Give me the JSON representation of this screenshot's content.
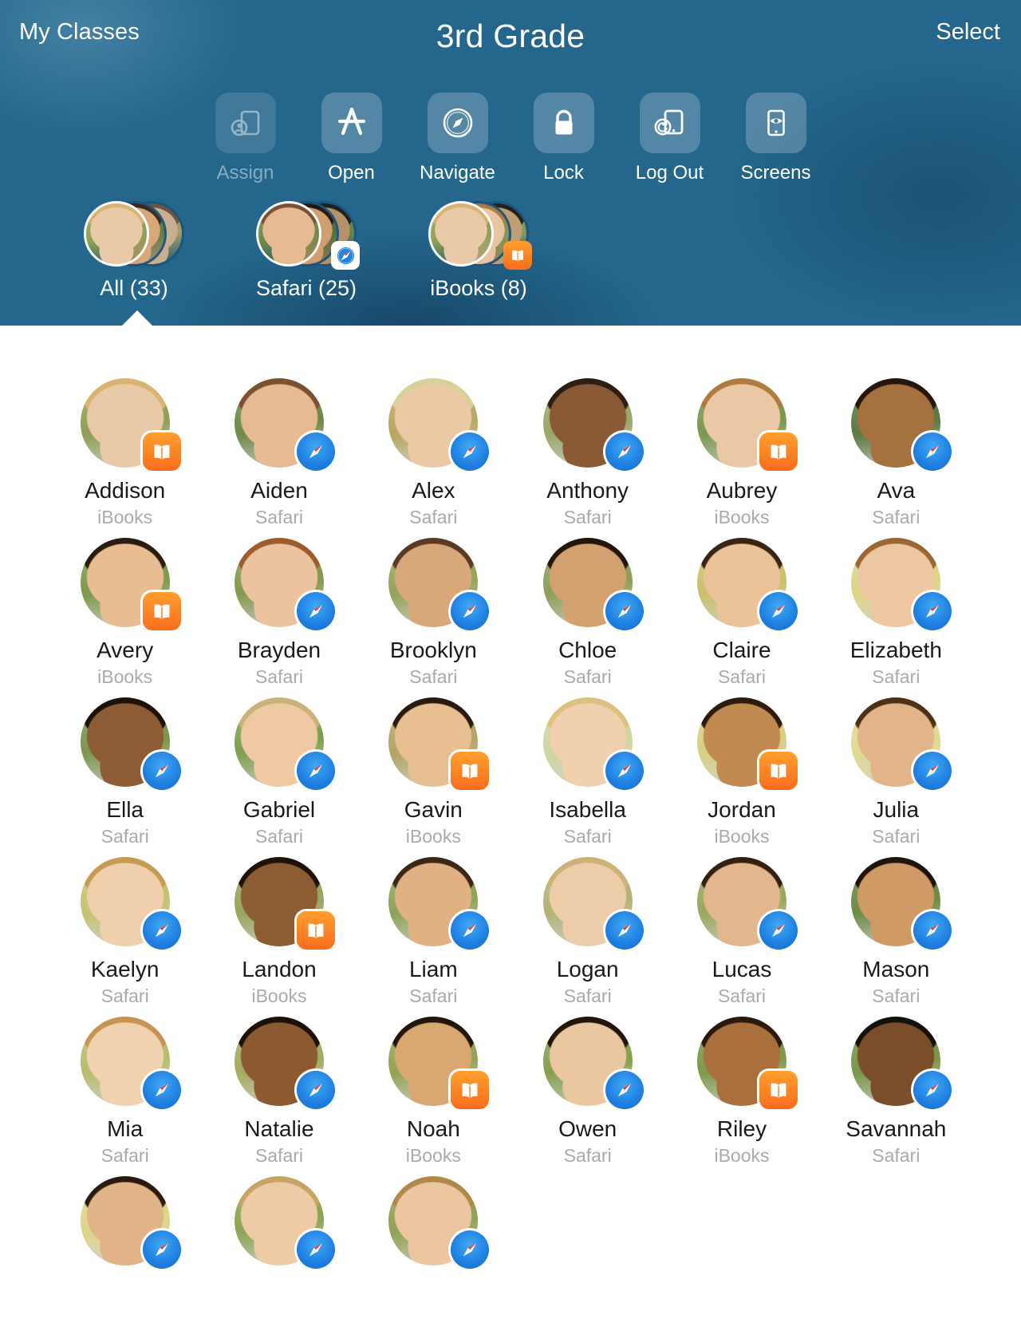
{
  "nav": {
    "back_label": "My Classes",
    "title": "3rd Grade",
    "select_label": "Select"
  },
  "toolbar": {
    "items": [
      {
        "label": "Assign",
        "icon": "assign-device-icon",
        "enabled": false
      },
      {
        "label": "Open",
        "icon": "app-store-icon",
        "enabled": true
      },
      {
        "label": "Navigate",
        "icon": "safari-compass-icon",
        "enabled": true
      },
      {
        "label": "Lock",
        "icon": "lock-icon",
        "enabled": true
      },
      {
        "label": "Log Out",
        "icon": "logout-device-icon",
        "enabled": true
      },
      {
        "label": "Screens",
        "icon": "screen-view-icon",
        "enabled": true
      }
    ]
  },
  "filters": {
    "items": [
      {
        "label": "All (33)",
        "key": "all",
        "badge": "none",
        "active": true
      },
      {
        "label": "Safari (25)",
        "key": "safari",
        "badge": "safari",
        "active": false
      },
      {
        "label": "iBooks (8)",
        "key": "ibooks",
        "badge": "ibooks",
        "active": false
      }
    ]
  },
  "colors": {
    "header_blue": "#24668c",
    "ibooks_orange": "#f87c20",
    "safari_blue": "#1f86e0",
    "name_text": "#1a1a1a",
    "app_text": "#a9a9ae"
  },
  "students": [
    {
      "name": "Addison",
      "app": "iBooks",
      "badge": "ibooks",
      "skin": "#e8c9a8",
      "hair": "#d9b471",
      "bg": "#8fa055"
    },
    {
      "name": "Aiden",
      "app": "Safari",
      "badge": "safari",
      "skin": "#e6bb93",
      "hair": "#7a5231",
      "bg": "#6f8a4a"
    },
    {
      "name": "Alex",
      "app": "Safari",
      "badge": "safari",
      "skin": "#ecc9a5",
      "hair": "#d8cf9a",
      "bg": "#b9a766"
    },
    {
      "name": "Anthony",
      "app": "Safari",
      "badge": "safari",
      "skin": "#8a5a36",
      "hair": "#2d1d12",
      "bg": "#9aa86a"
    },
    {
      "name": "Aubrey",
      "app": "iBooks",
      "badge": "ibooks",
      "skin": "#eac8a6",
      "hair": "#b07b3e",
      "bg": "#7e9750"
    },
    {
      "name": "Ava",
      "app": "Safari",
      "badge": "safari",
      "skin": "#a5713f",
      "hair": "#24160d",
      "bg": "#5d7a42"
    },
    {
      "name": "Avery",
      "app": "iBooks",
      "badge": "ibooks",
      "skin": "#e7bd91",
      "hair": "#2b1c10",
      "bg": "#7e9a4e"
    },
    {
      "name": "Brayden",
      "app": "Safari",
      "badge": "safari",
      "skin": "#ecc3a0",
      "hair": "#9e5c2c",
      "bg": "#87994f"
    },
    {
      "name": "Brooklyn",
      "app": "Safari",
      "badge": "safari",
      "skin": "#d8a87b",
      "hair": "#5a3a22",
      "bg": "#94a45c"
    },
    {
      "name": "Chloe",
      "app": "Safari",
      "badge": "safari",
      "skin": "#d3a070",
      "hair": "#241509",
      "bg": "#8d9f59"
    },
    {
      "name": "Claire",
      "app": "Safari",
      "badge": "safari",
      "skin": "#eac398",
      "hair": "#3a2415",
      "bg": "#cbbf6e"
    },
    {
      "name": "Elizabeth",
      "app": "Safari",
      "badge": "safari",
      "skin": "#edc7a1",
      "hair": "#9c6633",
      "bg": "#ddd489"
    },
    {
      "name": "Ella",
      "app": "Safari",
      "badge": "safari",
      "skin": "#8d5c34",
      "hair": "#1d1209",
      "bg": "#7d9750"
    },
    {
      "name": "Gabriel",
      "app": "Safari",
      "badge": "safari",
      "skin": "#eec9a4",
      "hair": "#c9b27a",
      "bg": "#7fa050"
    },
    {
      "name": "Gavin",
      "app": "iBooks",
      "badge": "ibooks",
      "skin": "#e7bf90",
      "hair": "#2a1a0e",
      "bg": "#b4a465"
    },
    {
      "name": "Isabella",
      "app": "Safari",
      "badge": "safari",
      "skin": "#f0d0ad",
      "hair": "#dcc07e",
      "bg": "#cfd5a0"
    },
    {
      "name": "Jordan",
      "app": "iBooks",
      "badge": "ibooks",
      "skin": "#c08a50",
      "hair": "#2d1b0d",
      "bg": "#d8cf84"
    },
    {
      "name": "Julia",
      "app": "Safari",
      "badge": "safari",
      "skin": "#e2b489",
      "hair": "#4e3017",
      "bg": "#e0da92"
    },
    {
      "name": "Kaelyn",
      "app": "Safari",
      "badge": "safari",
      "skin": "#efcfac",
      "hair": "#c79a52",
      "bg": "#c6c273"
    },
    {
      "name": "Landon",
      "app": "iBooks",
      "badge": "ibooks",
      "skin": "#8c5c33",
      "hair": "#1f1209",
      "bg": "#9aa55e"
    },
    {
      "name": "Liam",
      "app": "Safari",
      "badge": "safari",
      "skin": "#e0b183",
      "hair": "#3c2614",
      "bg": "#8fa35a"
    },
    {
      "name": "Logan",
      "app": "Safari",
      "badge": "safari",
      "skin": "#eccca9",
      "hair": "#cdb176",
      "bg": "#b3b377"
    },
    {
      "name": "Lucas",
      "app": "Safari",
      "badge": "safari",
      "skin": "#e3b78d",
      "hair": "#35200f",
      "bg": "#9aa85d"
    },
    {
      "name": "Mason",
      "app": "Safari",
      "badge": "safari",
      "skin": "#cf9a66",
      "hair": "#20140a",
      "bg": "#6e8b47"
    },
    {
      "name": "Mia",
      "app": "Safari",
      "badge": "safari",
      "skin": "#f0d2b0",
      "hair": "#c89352",
      "bg": "#b9bd6e"
    },
    {
      "name": "Natalie",
      "app": "Safari",
      "badge": "safari",
      "skin": "#8c5930",
      "hair": "#1c1008",
      "bg": "#a4ad62"
    },
    {
      "name": "Noah",
      "app": "iBooks",
      "badge": "ibooks",
      "skin": "#d9a872",
      "hair": "#241508",
      "bg": "#93a457"
    },
    {
      "name": "Owen",
      "app": "Safari",
      "badge": "safari",
      "skin": "#eac6a1",
      "hair": "#221508",
      "bg": "#86a04f"
    },
    {
      "name": "Riley",
      "app": "iBooks",
      "badge": "ibooks",
      "skin": "#a96f3d",
      "hair": "#2b1a0c",
      "bg": "#7f9a4d"
    },
    {
      "name": "Savannah",
      "app": "Safari",
      "badge": "safari",
      "skin": "#7a4e2b",
      "hair": "#15100a",
      "bg": "#7c964b"
    },
    {
      "name": "",
      "app": "",
      "badge": "safari",
      "skin": "#e0b486",
      "hair": "#2b1a0d",
      "bg": "#ded58c",
      "partial": true
    },
    {
      "name": "",
      "app": "",
      "badge": "safari",
      "skin": "#eecba7",
      "hair": "#c6a463",
      "bg": "#8ea455",
      "partial": true
    },
    {
      "name": "",
      "app": "",
      "badge": "safari",
      "skin": "#ebc6a0",
      "hair": "#b08848",
      "bg": "#90a254",
      "partial": true
    }
  ]
}
